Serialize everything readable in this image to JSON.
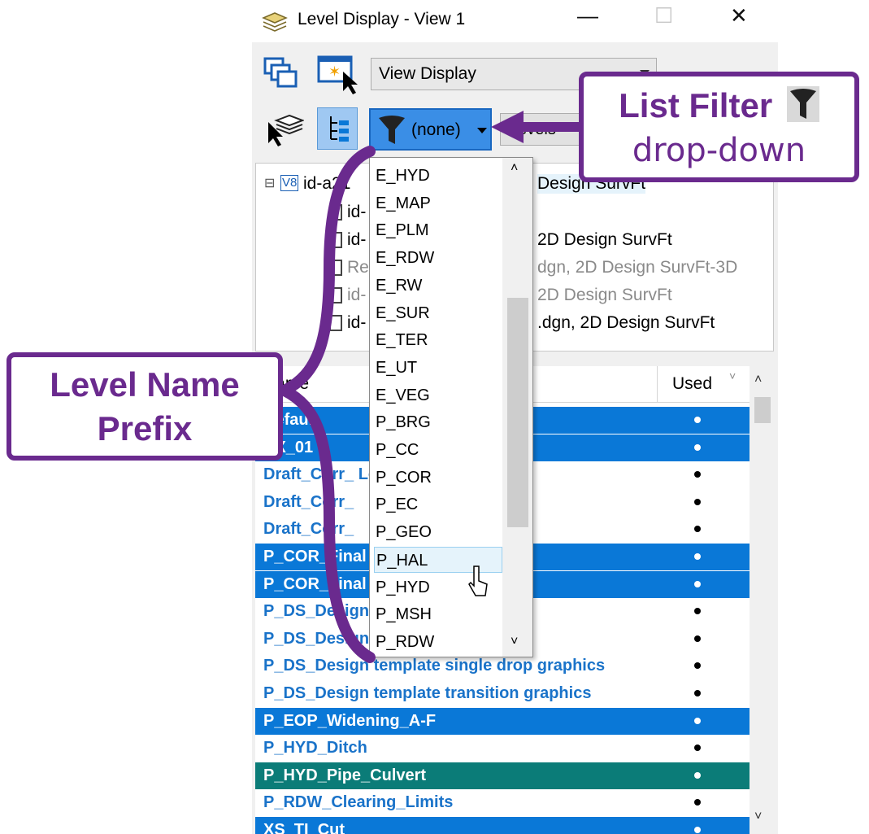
{
  "window": {
    "title": "Level Display - View 1",
    "minimize_glyph": "—",
    "maximize_glyph": "☐",
    "close_glyph": "✕"
  },
  "toolbar": {
    "view_select": "View Display",
    "filter_value": "(none)",
    "levels_button": "Levels"
  },
  "tree": {
    "root_label": "id-a21",
    "root_suffix": "Design SurvFt",
    "items": [
      {
        "label": "id-",
        "suffix": ""
      },
      {
        "label": "id-",
        "suffix": "2D Design SurvFt"
      },
      {
        "label": "Re",
        "suffix": "dgn, 2D Design SurvFt-3D"
      },
      {
        "label": "id-",
        "suffix": "2D Design SurvFt"
      },
      {
        "label": "id-",
        "suffix": ".dgn, 2D Design SurvFt"
      }
    ]
  },
  "grid": {
    "col_name": "Name",
    "col_used": "Used",
    "rows": [
      {
        "name": "Default",
        "style": "sel"
      },
      {
        "name": "UX_01",
        "style": "sel"
      },
      {
        "name": "Draft_Corr_ Location",
        "style": "plain"
      },
      {
        "name": "Draft_Corr_",
        "style": "plain"
      },
      {
        "name": "Draft_Corr_",
        "style": "plain"
      },
      {
        "name": "P_COR_Final s",
        "style": "sel"
      },
      {
        "name": "P_COR_Final Graphics",
        "style": "sel"
      },
      {
        "name": "P_DS_Design",
        "style": "plain"
      },
      {
        "name": "P_DS_Design graphics",
        "style": "plain"
      },
      {
        "name": "P_DS_Design template single drop graphics",
        "style": "plain"
      },
      {
        "name": "P_DS_Design template transition graphics",
        "style": "plain"
      },
      {
        "name": "P_EOP_Widening_A-F",
        "style": "sel"
      },
      {
        "name": "P_HYD_Ditch",
        "style": "plain"
      },
      {
        "name": "P_HYD_Pipe_Culvert",
        "style": "teal"
      },
      {
        "name": "P_RDW_Clearing_Limits",
        "style": "plain"
      },
      {
        "name": "XS_TI_Cut",
        "style": "sel"
      }
    ]
  },
  "dropdown": {
    "items": [
      "E_HYD",
      "E_MAP",
      "E_PLM",
      "E_RDW",
      "E_RW",
      "E_SUR",
      "E_TER",
      "E_UT",
      "E_VEG",
      "P_BRG",
      "P_CC",
      "P_COR",
      "P_EC",
      "P_GEO",
      "P_HAL",
      "P_HYD",
      "P_MSH",
      "P_RDW"
    ],
    "hovered": "P_HAL"
  },
  "callouts": {
    "list_filter_line1": "List Filter",
    "list_filter_line2": "drop-down",
    "level_prefix_line1": "Level Name",
    "level_prefix_line2": "Prefix"
  },
  "colors": {
    "accent_purple": "#6a2a8e",
    "selection_blue": "#0a78d7",
    "teal_row": "#0b7c78",
    "link_blue": "#1a73c9"
  }
}
